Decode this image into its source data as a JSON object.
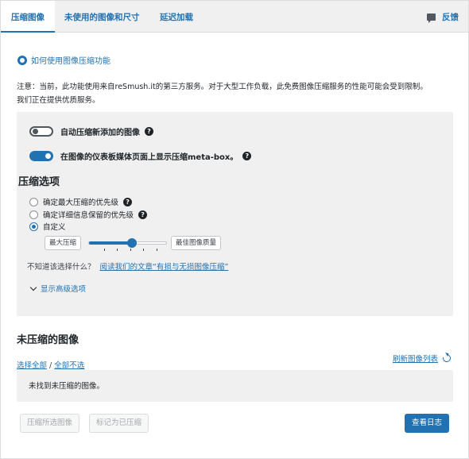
{
  "tabs": [
    {
      "label": "压缩图像"
    },
    {
      "label": "未使用的图像和尺寸"
    },
    {
      "label": "延迟加载"
    }
  ],
  "feedback": {
    "label": "反馈",
    "icon": "chat-icon"
  },
  "help_link": {
    "label": "如何使用图像压缩功能",
    "icon": "lifebuoy-icon"
  },
  "notice": {
    "line1": "注意：当前，此功能使用来自reSmush.it的第三方服务。对于大型工作负载，此免费图像压缩服务的性能可能会受到限制。",
    "line2": "我们正在提供优质服务。"
  },
  "options": {
    "auto_compress": {
      "label": "自动压缩新添加的图像",
      "enabled": false
    },
    "meta_box": {
      "label": "在图像的仪表板媒体页面上显示压缩meta-box。",
      "enabled": true
    },
    "section_title": "压缩选项",
    "radios": [
      {
        "label": "确定最大压缩的优先级",
        "checked": false,
        "has_help": true
      },
      {
        "label": "确定详细信息保留的优先级",
        "checked": false,
        "has_help": true
      },
      {
        "label": "自定义",
        "checked": true,
        "has_help": false
      }
    ],
    "slider": {
      "min_label": "最大压缩",
      "max_label": "最佳图像质量",
      "value": 0.55
    },
    "hint_text": "不知道该选择什么？",
    "hint_link": "阅读我们的文章“有损与无损图像压缩”",
    "advanced_label": "显示高级选项"
  },
  "uncompressed": {
    "title": "未压缩的图像",
    "select_all": "选择全部",
    "separator": "/",
    "select_none": "全部不选",
    "refresh_label": "刷新图像列表",
    "empty_message": "未找到未压缩的图像。",
    "compress_selected": "压缩所选图像",
    "mark_compressed": "标记为已压缩",
    "view_log": "查看日志"
  },
  "colors": {
    "accent": "#2271b1",
    "panel_bg": "#f0f0f1"
  }
}
